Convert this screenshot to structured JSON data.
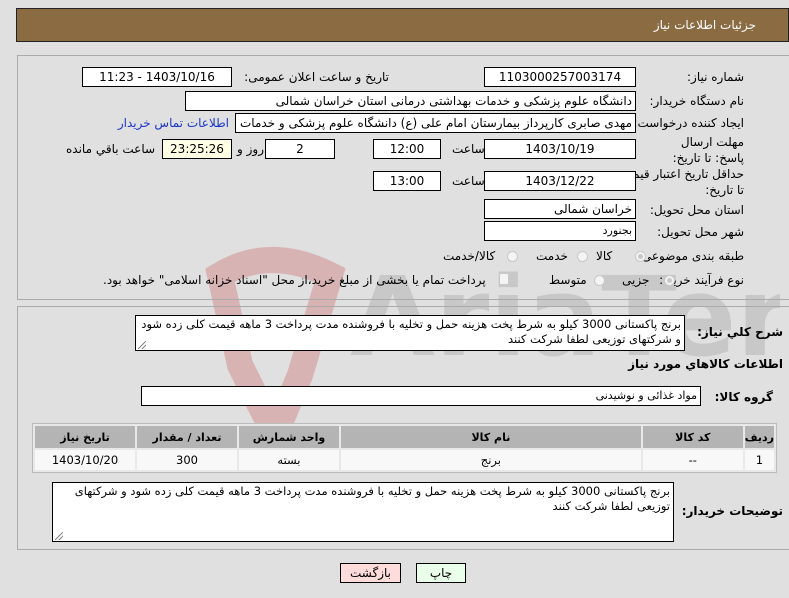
{
  "header": {
    "title": "جزئیات اطلاعات نیاز"
  },
  "fields": {
    "need_number": {
      "label": "شماره نیاز:",
      "value": "1103000257003174"
    },
    "announce_datetime": {
      "label": "تاریخ و ساعت اعلان عمومی:",
      "value": "1403/10/16 - 11:23"
    },
    "buyer_org": {
      "label": "نام دستگاه خریدار:",
      "value": "دانشگاه علوم پزشکی و خدمات بهداشتی درمانی استان خراسان شمالی"
    },
    "requester": {
      "label": "ایجاد کننده درخواست:",
      "value": "مهدی صابری کارپرداز بیمارستان امام علی (ع) دانشگاه علوم پزشکی و خدمات بهداشتی"
    },
    "buyer_contact_link": "اطلاعات تماس خریدار",
    "response_deadline": {
      "label": "مهلت ارسال پاسخ: تا تاریخ:",
      "date": "1403/10/19",
      "time_label": "ساعت",
      "time": "12:00",
      "days": "2",
      "days_label": "روز و",
      "remaining": "23:25:26",
      "remaining_label": "ساعت باقي مانده"
    },
    "price_validity": {
      "label": "حداقل تاریخ اعتبار قیمت: تا تاریخ:",
      "date": "1403/12/22",
      "time_label": "ساعت",
      "time": "13:00"
    },
    "delivery_province": {
      "label": "استان محل تحویل:",
      "value": "خراسان شمالی"
    },
    "delivery_city": {
      "label": "شهر محل تحویل:",
      "value": "بجنورد"
    },
    "subject_class": {
      "label": "طبقه بندی موضوعی:",
      "options": [
        "کالا",
        "خدمت",
        "کالا/خدمت"
      ],
      "selected": "کالا"
    },
    "purchase_type": {
      "label": "نوع فرآیند خرید :",
      "options": [
        "جزیی",
        "متوسط"
      ],
      "selected": "جزیی",
      "treasury_note": "پرداخت تمام یا بخشی از مبلغ خرید،از محل \"اسناد خزانه اسلامی\" خواهد بود."
    }
  },
  "description": {
    "label": "شرح کلي نیاز:",
    "value": "برنج پاکستانی 3000 کیلو به شرط پخت هزینه حمل و تخلیه با فروشنده مدت پرداخت 3 ماهه قیمت کلی زده شود و شرکتهای توزیعی لطفا شرکت کنند"
  },
  "items_section": {
    "title": "اطلاعات کالاهاي مورد نیاز",
    "group_label": "گروه کالا:",
    "group_value": "مواد غذائی و نوشیدنی",
    "columns": [
      "ردیف",
      "کد کالا",
      "نام کالا",
      "واحد شمارش",
      "تعداد / مقدار",
      "تاریخ نیاز"
    ],
    "rows": [
      [
        "1",
        "--",
        "برنج",
        "بسته",
        "300",
        "1403/10/20"
      ]
    ]
  },
  "buyer_notes": {
    "label": "توضیحات خریدار:",
    "value": "برنج پاکستانی 3000 کیلو به شرط پخت هزینه حمل و تخلیه با فروشنده مدت پرداخت 3 ماهه قیمت کلی زده شود و شرکتهای توزیعی لطفا شرکت کنند"
  },
  "buttons": {
    "print": "چاپ",
    "back": "بازگشت"
  },
  "colors": {
    "header_bg": "#8b6b42",
    "print_bg": "#eaffea",
    "back_bg": "#ffdcdc",
    "link": "#1a37c8"
  }
}
